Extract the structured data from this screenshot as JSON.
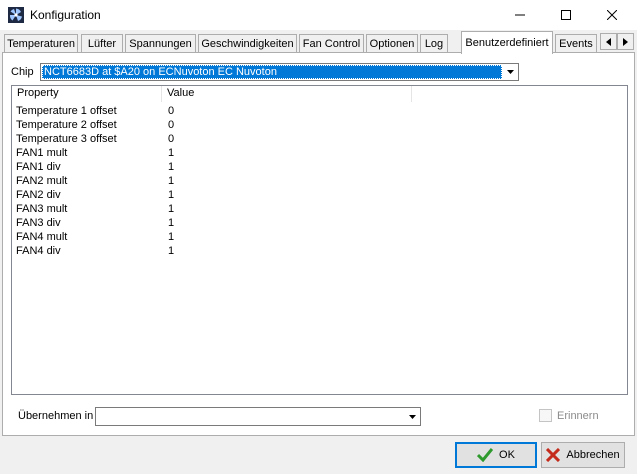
{
  "window": {
    "title": "Konfiguration",
    "icon": "app-fan-icon",
    "controls": {
      "minimize": "minimize-icon",
      "maximize": "maximize-icon",
      "close": "close-icon"
    }
  },
  "tabs": [
    {
      "label": "Temperaturen"
    },
    {
      "label": "Lüfter"
    },
    {
      "label": "Spannungen"
    },
    {
      "label": "Geschwindigkeiten"
    },
    {
      "label": "Fan Control"
    },
    {
      "label": "Optionen"
    },
    {
      "label": "Log"
    },
    {
      "label": "Benutzerdefiniert",
      "active": true
    },
    {
      "label": "Events"
    }
  ],
  "chip": {
    "label": "Chip",
    "value": "NCT6683D at $A20 on ECNuvoton EC Nuvoton"
  },
  "table": {
    "columns": [
      "Property",
      "Value"
    ],
    "rows": [
      {
        "property": "Temperature 1 offset",
        "value": "0"
      },
      {
        "property": "Temperature 2 offset",
        "value": "0"
      },
      {
        "property": "Temperature 3 offset",
        "value": "0"
      },
      {
        "property": "FAN1 mult",
        "value": "1"
      },
      {
        "property": "FAN1 div",
        "value": "1"
      },
      {
        "property": "FAN2 mult",
        "value": "1"
      },
      {
        "property": "FAN2 div",
        "value": "1"
      },
      {
        "property": "FAN3 mult",
        "value": "1"
      },
      {
        "property": "FAN3 div",
        "value": "1"
      },
      {
        "property": "FAN4 mult",
        "value": "1"
      },
      {
        "property": "FAN4 div",
        "value": "1"
      }
    ]
  },
  "apply": {
    "label": "Übernehmen in",
    "value": ""
  },
  "remember": {
    "label": "Erinnern",
    "checked": false,
    "enabled": false
  },
  "buttons": {
    "ok": "OK",
    "cancel": "Abbrechen"
  },
  "colors": {
    "selection": "#0078d7",
    "ok_check": "#2e9a2e",
    "cancel_x": "#c42b1c"
  }
}
